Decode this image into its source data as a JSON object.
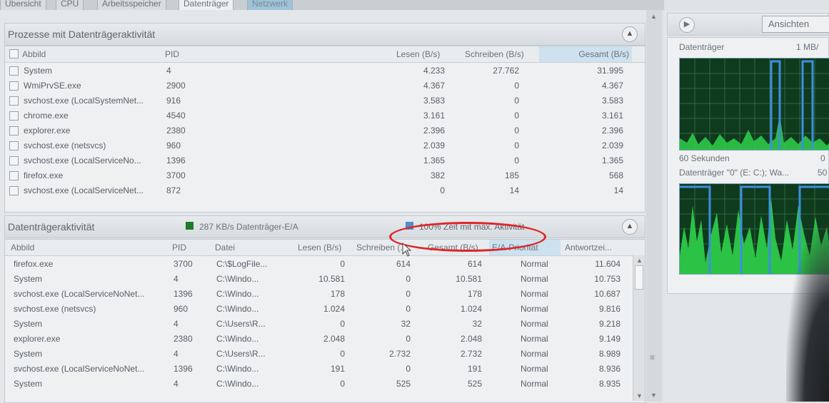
{
  "tabs": [
    "Übersicht",
    "CPU",
    "Arbeitsspeicher",
    "Datenträger",
    "Netzwerk"
  ],
  "processes": {
    "title": "Prozesse mit Datenträgeraktivität",
    "columns": {
      "image": "Abbild",
      "pid": "PID",
      "read": "Lesen (B/s)",
      "write": "Schreiben (B/s)",
      "total": "Gesamt (B/s)"
    },
    "rows": [
      {
        "image": "System",
        "pid": "4",
        "read": "4.233",
        "write": "27.762",
        "total": "31.995"
      },
      {
        "image": "WmiPrvSE.exe",
        "pid": "2900",
        "read": "4.367",
        "write": "0",
        "total": "4.367"
      },
      {
        "image": "svchost.exe (LocalSystemNet...",
        "pid": "916",
        "read": "3.583",
        "write": "0",
        "total": "3.583"
      },
      {
        "image": "chrome.exe",
        "pid": "4540",
        "read": "3.161",
        "write": "0",
        "total": "3.161"
      },
      {
        "image": "explorer.exe",
        "pid": "2380",
        "read": "2.396",
        "write": "0",
        "total": "2.396"
      },
      {
        "image": "svchost.exe (netsvcs)",
        "pid": "960",
        "read": "2.039",
        "write": "0",
        "total": "2.039"
      },
      {
        "image": "svchost.exe (LocalServiceNo...",
        "pid": "1396",
        "read": "1.365",
        "write": "0",
        "total": "1.365"
      },
      {
        "image": "firefox.exe",
        "pid": "3700",
        "read": "382",
        "write": "185",
        "total": "568"
      },
      {
        "image": "svchost.exe (LocalServiceNet...",
        "pid": "872",
        "read": "0",
        "write": "14",
        "total": "14"
      }
    ]
  },
  "activity": {
    "title": "Datenträgeraktivität",
    "io_label": "287 KB/s Datenträger-E/A",
    "max_label": "100% Zeit mit max. Aktivität",
    "io_color": "#1f7a2b",
    "max_color": "#4f8fc5",
    "columns": {
      "image": "Abbild",
      "pid": "PID",
      "file": "Datei",
      "read": "Lesen (B/s)",
      "write": "Schreiben (...",
      "total": "Gesamt (B/s)",
      "prio": "E/A-Priorität",
      "resp": "Antwortzei..."
    },
    "rows": [
      {
        "image": "firefox.exe",
        "pid": "3700",
        "file": "C:\\$LogFile...",
        "read": "0",
        "write": "614",
        "total": "614",
        "prio": "Normal",
        "resp": "11.604"
      },
      {
        "image": "System",
        "pid": "4",
        "file": "C:\\Windo...",
        "read": "10.581",
        "write": "0",
        "total": "10.581",
        "prio": "Normal",
        "resp": "10.753"
      },
      {
        "image": "svchost.exe (LocalServiceNoNet...",
        "pid": "1396",
        "file": "C:\\Windo...",
        "read": "178",
        "write": "0",
        "total": "178",
        "prio": "Normal",
        "resp": "10.687"
      },
      {
        "image": "svchost.exe (netsvcs)",
        "pid": "960",
        "file": "C:\\Windo...",
        "read": "1.024",
        "write": "0",
        "total": "1.024",
        "prio": "Normal",
        "resp": "9.816"
      },
      {
        "image": "System",
        "pid": "4",
        "file": "C:\\Users\\R...",
        "read": "0",
        "write": "32",
        "total": "32",
        "prio": "Normal",
        "resp": "9.218"
      },
      {
        "image": "explorer.exe",
        "pid": "2380",
        "file": "C:\\Windo...",
        "read": "2.048",
        "write": "0",
        "total": "2.048",
        "prio": "Normal",
        "resp": "9.149"
      },
      {
        "image": "System",
        "pid": "4",
        "file": "C:\\Users\\R...",
        "read": "0",
        "write": "2.732",
        "total": "2.732",
        "prio": "Normal",
        "resp": "8.989"
      },
      {
        "image": "svchost.exe (LocalServiceNoNet...",
        "pid": "1396",
        "file": "C:\\Windo...",
        "read": "191",
        "write": "0",
        "total": "191",
        "prio": "Normal",
        "resp": "8.936"
      },
      {
        "image": "System",
        "pid": "4",
        "file": "C:\\Windo...",
        "read": "0",
        "write": "525",
        "total": "525",
        "prio": "Normal",
        "resp": "8.935"
      }
    ]
  },
  "right": {
    "views_button": "Ansichten",
    "graph1_label": "Datenträger",
    "graph1_scale": "1 MB/",
    "graph1_time": "60 Sekunden",
    "graph1_zero": "0",
    "graph2_label": "Datenträger \"0\" (E: C:); Wa...",
    "graph2_scale": "50"
  }
}
